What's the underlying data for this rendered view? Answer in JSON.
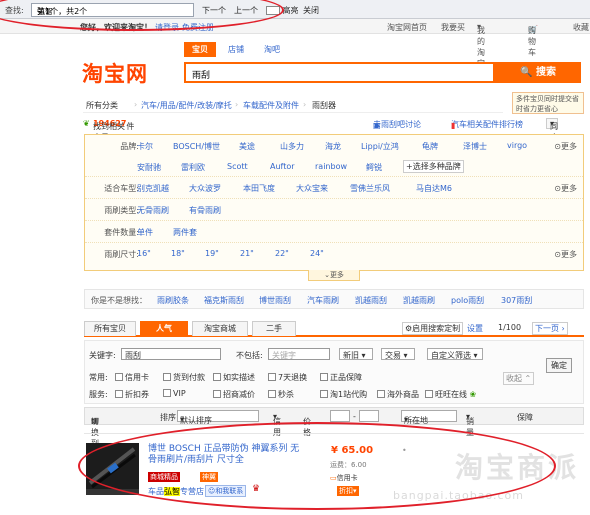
{
  "findbar": {
    "label": "查找:",
    "query": "弘智",
    "count": "第1个，共2个",
    "next": "下一个",
    "prev": "上一个",
    "highlight": "高亮",
    "close": "关闭"
  },
  "sitebar": {
    "welcome": "您好，欢迎来淘宝！",
    "login": "请登录",
    "register": "免费注册",
    "home": "淘宝网首页",
    "buy": "我要买",
    "mytaobao": "我的淘宝",
    "cart": "购物车",
    "fav": "收藏"
  },
  "header": {
    "logo": "淘宝网",
    "tabs": [
      "宝贝",
      "店铺",
      "淘吧"
    ],
    "query": "雨刮",
    "search_btn": "搜索"
  },
  "breadcrumb": [
    "所有分类",
    "汽车/用品/配件/改装/摩托",
    "车载配件及附件",
    "雨刮器"
  ],
  "tip": "多件宝贝同时提交省时省力更省心",
  "result": {
    "prefix": "找到相关宝贝",
    "count": "194627",
    "suffix": "件",
    "links": [
      "去雨刮吧讨论",
      "汽车相关配件排行榜"
    ],
    "view": "同店购"
  },
  "filter": {
    "brand_label": "品牌:",
    "brands_row1": [
      "卡尔",
      "BOSCH/博世",
      "美途",
      "山多力",
      "海龙",
      "Lippi/立鸿",
      "龟牌",
      "泽博士",
      "virgo"
    ],
    "brands_row2": [
      "安耐驰",
      "雷利欧",
      "Scott",
      "Auftor",
      "rainbow",
      "鳄锐"
    ],
    "select_more": "+选择多种品牌",
    "more": "更多",
    "car_label": "适合车型:",
    "cars": [
      "别克凯越",
      "大众波罗",
      "本田飞度",
      "大众宝来",
      "雪佛兰乐风",
      "马自达M6"
    ],
    "type_label": "雨刷类型:",
    "types": [
      "无骨雨刷",
      "有骨雨刷"
    ],
    "kit_label": "套件数量:",
    "kits": [
      "单件",
      "两件套"
    ],
    "size_label": "雨刷尺寸:",
    "sizes": [
      "16\"",
      "18\"",
      "19\"",
      "21\"",
      "22\"",
      "24\""
    ],
    "expand": "更多"
  },
  "related": {
    "label": "你是不是想找：",
    "items": [
      "雨刷胶条",
      "福克斯雨刮",
      "博世雨刮",
      "汽车雨刷",
      "凯越雨刮",
      "凯越雨刷",
      "polo雨刮",
      "307雨刮"
    ]
  },
  "tabs": [
    "所有宝贝",
    "人气",
    "淘宝商城",
    "二手"
  ],
  "tools": {
    "custom": "启用搜索定制",
    "settings": "设置",
    "page": "1/100",
    "next": "下一页"
  },
  "kw": {
    "label": "关键字:",
    "value": "雨刮",
    "exclude_label": "不包括:",
    "exclude_ph": "关键字",
    "sel1": "新旧",
    "sel2": "交易",
    "sel3": "自定义筛选",
    "confirm": "确定",
    "collapse": "收起",
    "common_label": "常用:",
    "service_label": "服务:",
    "row1": [
      "信用卡",
      "货到付款",
      "如实描述",
      "7天退换",
      "正品保障"
    ],
    "row2": [
      "折扣券",
      "VIP",
      "招商减价",
      "秒杀",
      "淘1站代购",
      "海外商品",
      "旺旺在线"
    ]
  },
  "sort": {
    "switch": "切换到大图",
    "sort_label": "排序",
    "sort_value": "默认排序",
    "credit": "信用",
    "price": "价格",
    "location": "所在地",
    "sales": "销量",
    "guarantee": "保障"
  },
  "item": {
    "title": "博世 BOSCH 正品带防伪 神翼系列 无骨雨刷片/雨刮片 尺寸全",
    "badge1": "商城精品",
    "badge2": "神翼",
    "shop_prefix": "车品",
    "shop_hl": "弘智",
    "shop_suffix": "专营店",
    "contact": "和我联系",
    "price": "¥ 65.00",
    "ship": "运费：6.00",
    "credit": "信用卡",
    "discount": "折扣"
  },
  "watermark": {
    "big": "淘宝商派",
    "small": "bangpai.taobao.com"
  },
  "colors": {
    "accent": "#ff6600",
    "link": "#3366cc",
    "annotation": "#e0202a"
  }
}
